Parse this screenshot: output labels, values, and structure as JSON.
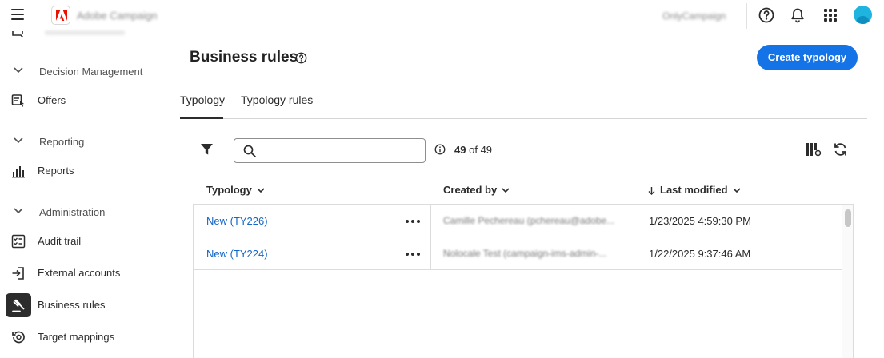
{
  "topbar": {
    "app_name": "Adobe Campaign",
    "org_name": "OnlyCampaign",
    "icons": [
      "menu-icon",
      "help-icon",
      "bell-icon",
      "apps-grid-icon",
      "avatar"
    ]
  },
  "sidebar": {
    "sections": [
      {
        "label": "Decision Management",
        "items": [
          {
            "label": "Offers",
            "icon": "offers-icon"
          }
        ]
      },
      {
        "label": "Reporting",
        "items": [
          {
            "label": "Reports",
            "icon": "bar-chart-icon"
          }
        ]
      },
      {
        "label": "Administration",
        "items": [
          {
            "label": "Audit trail",
            "icon": "checklist-icon"
          },
          {
            "label": "External accounts",
            "icon": "sign-in-icon"
          },
          {
            "label": "Business rules",
            "icon": "gavel-icon",
            "active": true
          },
          {
            "label": "Target mappings",
            "icon": "target-history-icon"
          }
        ]
      }
    ]
  },
  "main": {
    "title": "Business rules",
    "create_button": "Create typology",
    "tabs": [
      {
        "label": "Typology",
        "active": true
      },
      {
        "label": "Typology rules",
        "active": false
      }
    ],
    "search": {
      "placeholder": "",
      "value": ""
    },
    "count": {
      "shown": "49",
      "of_label": "of",
      "total": "49"
    },
    "columns": [
      {
        "label": "Typology"
      },
      {
        "label": "Created by"
      },
      {
        "label": "Last modified",
        "sort": "descending"
      }
    ],
    "rows": [
      {
        "typology": "New (TY226)",
        "created_by": "Camille Pechereau (pchereau@adobe...",
        "last_modified": "1/23/2025 4:59:30 PM"
      },
      {
        "typology": "New (TY224)",
        "created_by": "Nolocale Test (campaign-ims-admin-...",
        "last_modified": "1/22/2025 9:37:46 AM"
      }
    ]
  },
  "colors": {
    "accent": "#1473e6",
    "link": "#1466c9",
    "avatar": "#1fb3e0",
    "adobe_red": "#eb1000"
  }
}
